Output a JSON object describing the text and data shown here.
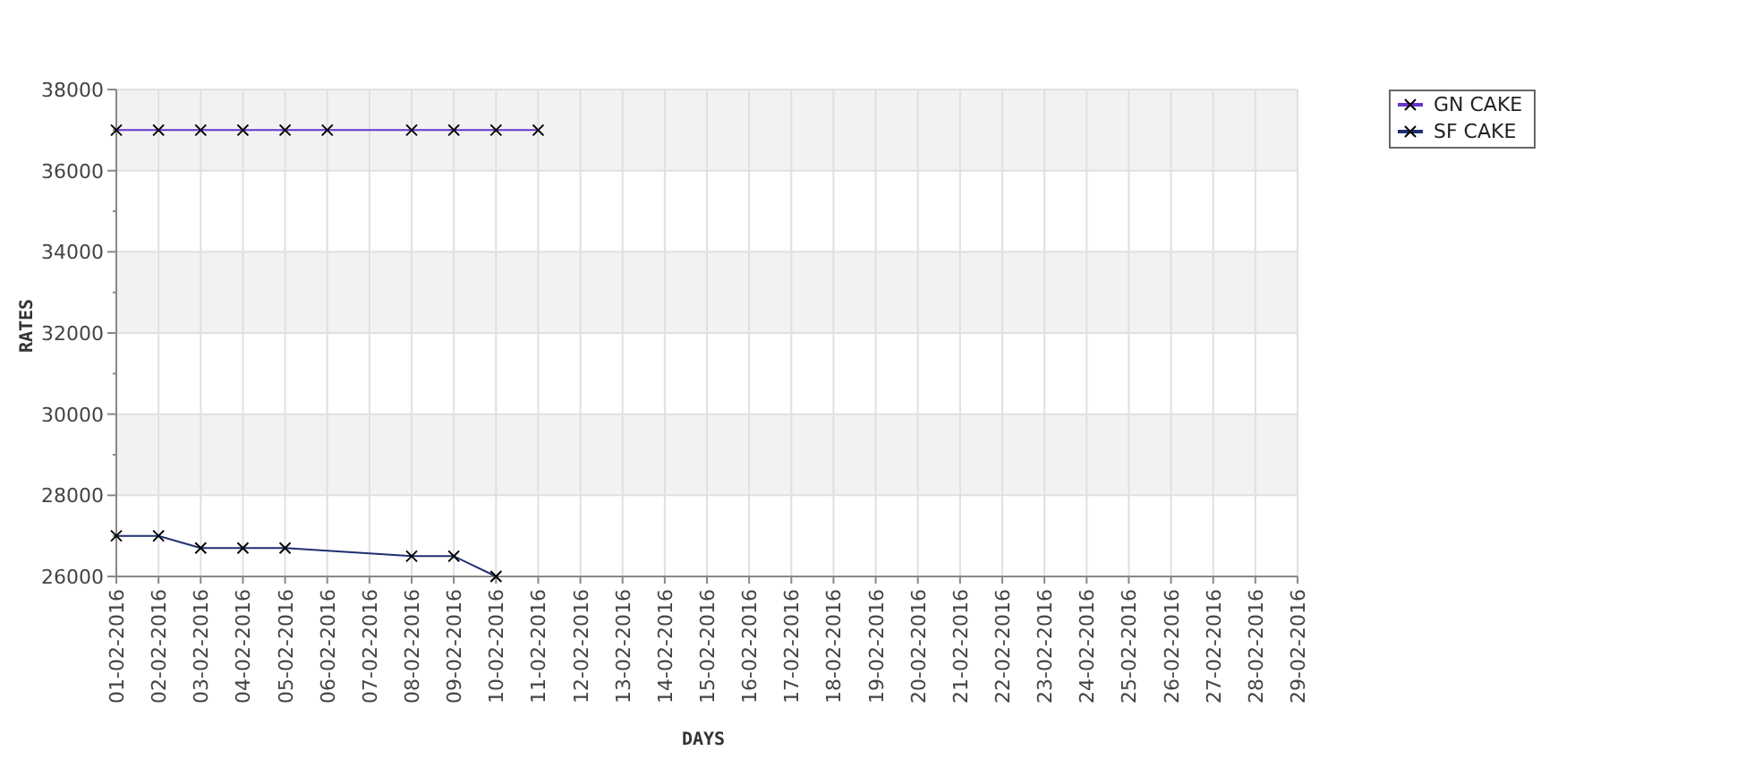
{
  "chart": {
    "chart_data": {
      "type": "line",
      "xlabel": "DAYS",
      "ylabel": "RATES",
      "categories": [
        "01-02-2016",
        "02-02-2016",
        "03-02-2016",
        "04-02-2016",
        "05-02-2016",
        "06-02-2016",
        "07-02-2016",
        "08-02-2016",
        "09-02-2016",
        "10-02-2016",
        "11-02-2016",
        "12-02-2016",
        "13-02-2016",
        "14-02-2016",
        "15-02-2016",
        "16-02-2016",
        "17-02-2016",
        "18-02-2016",
        "19-02-2016",
        "20-02-2016",
        "21-02-2016",
        "22-02-2016",
        "23-02-2016",
        "24-02-2016",
        "25-02-2016",
        "26-02-2016",
        "27-02-2016",
        "28-02-2016",
        "29-02-2016"
      ],
      "series": [
        {
          "name": "GN CAKE",
          "color": "#6633cc",
          "marker": "x",
          "values": [
            37000,
            37000,
            37000,
            37000,
            37000,
            37000,
            null,
            37000,
            37000,
            37000,
            37000,
            null,
            null,
            null,
            null,
            null,
            null,
            null,
            null,
            null,
            null,
            null,
            null,
            null,
            null,
            null,
            null,
            null,
            null
          ]
        },
        {
          "name": "SF CAKE",
          "color": "#1f2f6f",
          "marker": "x",
          "values": [
            27000,
            27000,
            26700,
            26700,
            26700,
            null,
            null,
            26500,
            26500,
            26000,
            null,
            null,
            null,
            null,
            null,
            null,
            null,
            null,
            null,
            null,
            null,
            null,
            null,
            null,
            null,
            null,
            null,
            null,
            null
          ]
        }
      ],
      "ylim": [
        26000,
        38000
      ],
      "grid": true,
      "legend": true,
      "yticks": [
        26000,
        28000,
        30000,
        32000,
        34000,
        36000,
        38000
      ]
    }
  }
}
